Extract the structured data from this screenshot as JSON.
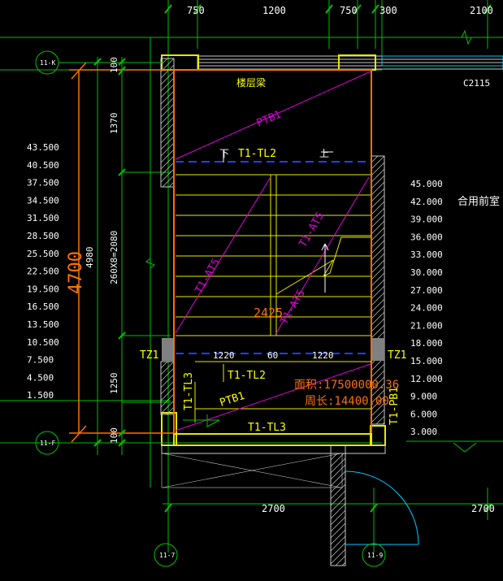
{
  "colors": {
    "background": "#000000",
    "dim": "#ffffff",
    "grid": "#00c000",
    "axis_bubble": "#00c000",
    "wall": "#c8c8c8",
    "stair": "#e8e800",
    "boundary": "#ff7000",
    "diag": "#e000e0",
    "dashed": "#2040ff",
    "label_yellow": "#ffff00",
    "cyan": "#00c8ff"
  },
  "icons": {
    "up_arrow": "arrow-up-icon",
    "break_line": "break-line-icon",
    "level_marker": "level-triangle-icon"
  },
  "top_dims": [
    "750",
    "1200",
    "750",
    "300",
    "2100"
  ],
  "bottom_dims": [
    "2700",
    "2700"
  ],
  "axis_labels": {
    "row_top": "11-K",
    "row_bottom": "11-F",
    "col_left": "11-7",
    "col_right": "11-9"
  },
  "left_dims": {
    "total_orange": "4700",
    "total": "4980",
    "top_100": "100",
    "seg_1370": "1370",
    "flight": "260X8=2080",
    "seg_1250": "1250",
    "bottom_100": "100"
  },
  "left_elevations": [
    "43.500",
    "40.500",
    "37.500",
    "34.500",
    "31.500",
    "28.500",
    "25.500",
    "22.500",
    "19.500",
    "16.500",
    "13.500",
    "10.500",
    "7.500",
    "4.500",
    "1.500"
  ],
  "right_elevations": [
    "45.000",
    "42.000",
    "39.000",
    "36.000",
    "33.000",
    "30.000",
    "27.000",
    "24.000",
    "21.000",
    "18.000",
    "15.000",
    "12.000",
    "9.000",
    "6.000",
    "3.000"
  ],
  "labels": {
    "floor_beam": "楼层梁",
    "window": "C2115",
    "room": "合用前室",
    "ptb1_top": "PTB1",
    "tl2_top": "T1-TL2",
    "down": "下",
    "up": "上",
    "at5_left": "T1-AT5",
    "at5_right": "T1-AT5",
    "at5_lower": "T1-AT5",
    "width_2425": "2425",
    "tz1_left": "TZ1",
    "tz1_right": "TZ1",
    "w1220_left": "1220",
    "w60": "60",
    "w1220_right": "1220",
    "tl2_bottom": "T1-TL2",
    "tl3_left": "T1-TL3",
    "ptb1_bottom": "PTB1",
    "tl3_bottom": "T1-TL3",
    "pb1": "T1-PB1",
    "area": "面积:17500000.36",
    "perimeter": "周长:14400.00"
  }
}
